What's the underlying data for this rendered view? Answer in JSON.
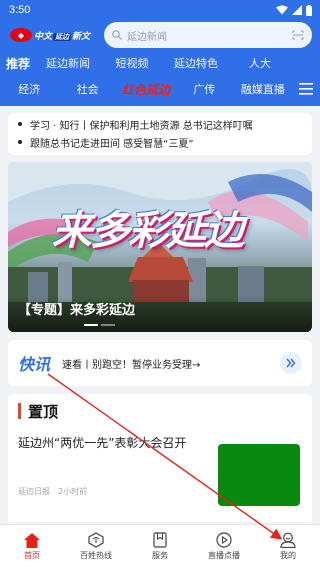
{
  "status_bar": {
    "time": "3:50"
  },
  "header": {
    "logo_text": "中文",
    "logo_badge": "延边",
    "logo_text2": "新文",
    "search_placeholder": "延边新闻",
    "channels_row1": [
      "推荐",
      "延边新闻",
      "短视频",
      "延边特色",
      "人大"
    ],
    "channels_row2": [
      "经济",
      "社会",
      "红色延边",
      "广传",
      "融媒直播"
    ]
  },
  "headlines": [
    "学习 · 知行丨保护和利用土地资源 总书记这样叮嘱",
    "跟随总书记走进田间 感受智慧“三夏”"
  ],
  "banner": {
    "big_text": "来多彩延边",
    "caption": "【专题】来多彩延边"
  },
  "quick_news": {
    "logo": "快讯",
    "text": "速看丨别跑空！暂停业务受理→"
  },
  "pinned": {
    "section_title": "置顶",
    "item_title": "延边州“两优一先”表彰大会召开",
    "source": "延边日报",
    "time": "2小时前"
  },
  "bottom_nav": [
    {
      "label": "首页",
      "icon": "home-icon"
    },
    {
      "label": "百姓热线",
      "icon": "hotline-icon"
    },
    {
      "label": "服务",
      "icon": "service-icon"
    },
    {
      "label": "直播点播",
      "icon": "play-icon"
    },
    {
      "label": "我的",
      "icon": "profile-icon"
    }
  ],
  "colors": {
    "header_blue": "#2f6fe8",
    "accent_red": "#e8201a",
    "thumb_green": "#078a0f"
  }
}
